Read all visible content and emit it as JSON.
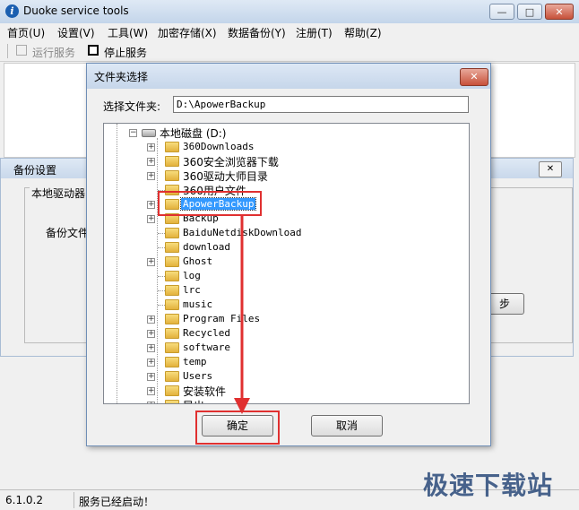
{
  "app": {
    "title": "Duoke service tools"
  },
  "caption_buttons": {
    "minimize": "—",
    "maximize": "□",
    "close": "✕"
  },
  "menu": [
    "首页(U)",
    "设置(V)",
    "工具(W)",
    "加密存储(X)",
    "数据备份(Y)",
    "注册(T)",
    "帮助(Z)"
  ],
  "toolbar": {
    "run_label": "运行服务",
    "stop_label": "停止服务"
  },
  "backup_window": {
    "title": "备份设置",
    "close": "✕",
    "group_label": "本地驱动器",
    "file_label": "备份文件",
    "next_label": "步"
  },
  "dialog": {
    "title": "文件夹选择",
    "close": "✕",
    "folder_label": "选择文件夹:",
    "path_value": "D:\\ApowerBackup",
    "drive_label": "本地磁盘 (D:)",
    "selected": "ApowerBackup",
    "folders": [
      {
        "name": "360Downloads",
        "expandable": true
      },
      {
        "name": "360安全浏览器下载",
        "expandable": true
      },
      {
        "name": "360驱动大师目录",
        "expandable": true
      },
      {
        "name": "360用户文件",
        "expandable": false
      },
      {
        "name": "ApowerBackup",
        "expandable": true
      },
      {
        "name": "Backup",
        "expandable": true
      },
      {
        "name": "BaiduNetdiskDownload",
        "expandable": false
      },
      {
        "name": "download",
        "expandable": false
      },
      {
        "name": "Ghost",
        "expandable": true
      },
      {
        "name": "log",
        "expandable": false
      },
      {
        "name": "lrc",
        "expandable": false
      },
      {
        "name": "music",
        "expandable": false
      },
      {
        "name": "Program Files",
        "expandable": true
      },
      {
        "name": "Recycled",
        "expandable": true
      },
      {
        "name": "software",
        "expandable": true
      },
      {
        "name": "temp",
        "expandable": true
      },
      {
        "name": "Users",
        "expandable": true
      },
      {
        "name": "安装软件",
        "expandable": true
      },
      {
        "name": "导出",
        "expandable": true
      }
    ],
    "ok_label": "确定",
    "cancel_label": "取消",
    "scroll_up": "▲",
    "scroll_down": "▼",
    "scroll_grip": "≡"
  },
  "statusbar": {
    "version": "6.1.0.2",
    "message": "服务已经启动！"
  },
  "watermark": "极速下载站",
  "colors": {
    "highlight_red": "#e03030",
    "selection_blue": "#3399ff"
  }
}
